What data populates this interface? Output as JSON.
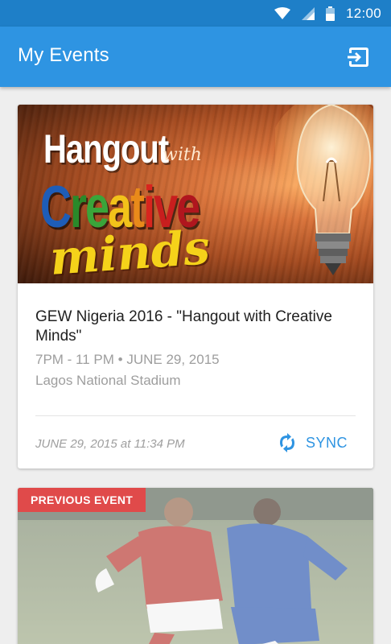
{
  "status_bar": {
    "time": "12:00"
  },
  "app_bar": {
    "title": "My Events",
    "logout_icon": "exit-icon"
  },
  "events": [
    {
      "banner": {
        "line1": "Hangout",
        "line2": "with",
        "line3_letters": [
          {
            "char": "C",
            "color": "#1e5db8"
          },
          {
            "char": "r",
            "color": "#2a8a2a"
          },
          {
            "char": "e",
            "color": "#3aa53a"
          },
          {
            "char": "a",
            "color": "#f2c21a"
          },
          {
            "char": "t",
            "color": "#e98a1a"
          },
          {
            "char": "i",
            "color": "#d8251e"
          },
          {
            "char": "v",
            "color": "#c81e1e"
          },
          {
            "char": "e",
            "color": "#b0161e"
          }
        ],
        "line4": "minds"
      },
      "title": "GEW Nigeria 2016 - \"Hangout with Creative Minds\"",
      "time": "7PM - 11 PM • JUNE 29, 2015",
      "venue": "Lagos National Stadium",
      "last_synced": "JUNE 29, 2015 at 11:34 PM",
      "sync_label": "SYNC",
      "sync_icon": "sync-icon"
    },
    {
      "badge": "PREVIOUS EVENT"
    }
  ],
  "colors": {
    "primary": "#2e94e2",
    "status_bar": "#1e7fc8",
    "badge": "#e04a4a"
  }
}
